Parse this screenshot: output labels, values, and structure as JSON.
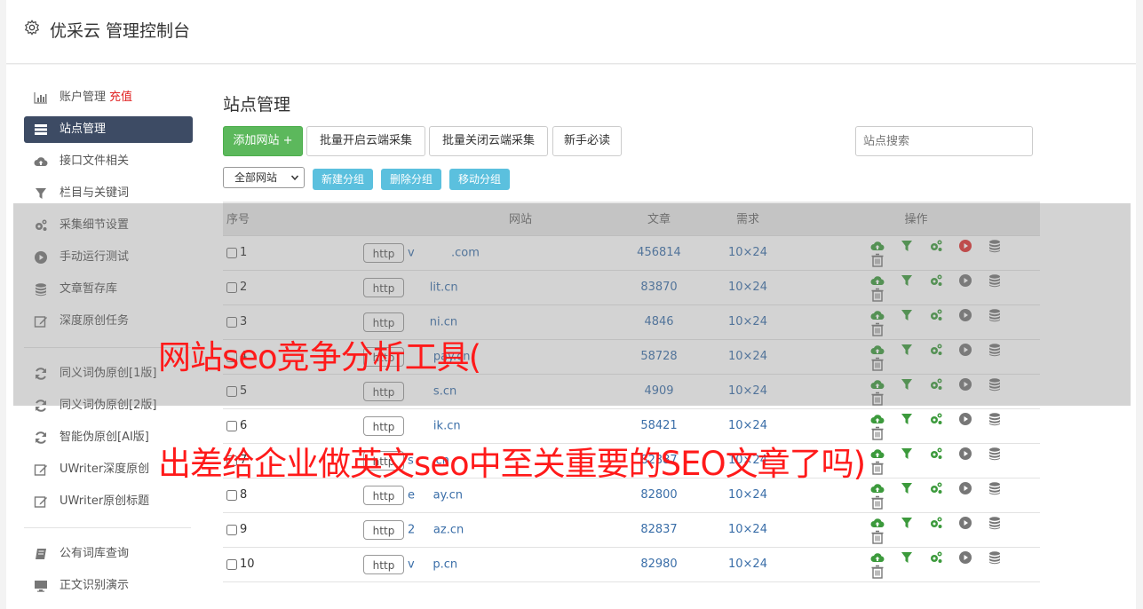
{
  "header": {
    "title": "优采云 管理控制台"
  },
  "sidebar": {
    "items": [
      {
        "label": "账户管理",
        "extra": "充值",
        "icon": "bar-chart-icon"
      },
      {
        "label": "站点管理",
        "icon": "server-list-icon",
        "active": true
      },
      {
        "label": "接口文件相关",
        "icon": "cloud-upload-icon"
      },
      {
        "label": "栏目与关键词",
        "icon": "filter-icon"
      },
      {
        "label": "采集细节设置",
        "icon": "cogs-icon"
      },
      {
        "label": "手动运行测试",
        "icon": "play-circle-icon"
      },
      {
        "label": "文章暂存库",
        "icon": "database-icon"
      },
      {
        "label": "深度原创任务",
        "icon": "edit-icon"
      }
    ],
    "items2": [
      {
        "label": "同义词伪原创[1版]",
        "icon": "refresh-icon"
      },
      {
        "label": "同义词伪原创[2版]",
        "icon": "refresh-icon"
      },
      {
        "label": "智能伪原创[AI版]",
        "icon": "refresh-icon"
      },
      {
        "label": "UWriter深度原创",
        "icon": "edit-icon"
      },
      {
        "label": "UWriter原创标题",
        "icon": "edit-icon"
      }
    ],
    "items3": [
      {
        "label": "公有词库查询",
        "icon": "book-icon"
      },
      {
        "label": "正文识别演示",
        "icon": "monitor-icon"
      }
    ]
  },
  "main": {
    "title": "站点管理",
    "buttons": {
      "add": "添加网站 +",
      "batch_open": "批量开启云端采集",
      "batch_close": "批量关闭云端采集",
      "newbie": "新手必读"
    },
    "search_placeholder": "站点搜索",
    "group_select": "全部网站",
    "group_buttons": {
      "new": "新建分组",
      "delete": "删除分组",
      "move": "移动分组"
    },
    "table": {
      "headers": [
        "序号",
        "网站",
        "文章",
        "需求",
        "操作"
      ],
      "rows": [
        {
          "idx": "1",
          "proto": "http",
          "domain": "v          .com",
          "articles": "456814",
          "need": "10×24"
        },
        {
          "idx": "2",
          "proto": "http",
          "domain": "      lit.cn",
          "articles": "83870",
          "need": "10×24"
        },
        {
          "idx": "3",
          "proto": "http",
          "domain": "      ni.cn",
          "articles": "4846",
          "need": "10×24"
        },
        {
          "idx": "4",
          "proto": "http",
          "domain": "       pay.cn",
          "articles": "58728",
          "need": "10×24"
        },
        {
          "idx": "5",
          "proto": "http",
          "domain": "       s.cn",
          "articles": "4909",
          "need": "10×24"
        },
        {
          "idx": "6",
          "proto": "http",
          "domain": "       ik.cn",
          "articles": "58421",
          "need": "10×24"
        },
        {
          "idx": "7",
          "proto": "http",
          "domain": "s     .cn",
          "articles": "82387",
          "need": "10×24"
        },
        {
          "idx": "8",
          "proto": "http",
          "domain": "e     ay.cn",
          "articles": "82800",
          "need": "10×24"
        },
        {
          "idx": "9",
          "proto": "http",
          "domain": "2     az.cn",
          "articles": "82837",
          "need": "10×24"
        },
        {
          "idx": "10",
          "proto": "http",
          "domain": "v     p.cn",
          "articles": "82980",
          "need": "10×24"
        }
      ]
    }
  },
  "overlay": {
    "line1": "网站seo竞争分析工具(",
    "line2": "出差给企业做英文seo中至关重要的SEO文章了吗)"
  },
  "colors": {
    "accent_green": "#5cb85c",
    "sidebar_active": "#3d4b64",
    "info_blue": "#5bc0de",
    "link_blue": "#3a6ea8",
    "overlay_red": "#ff1a1a"
  }
}
